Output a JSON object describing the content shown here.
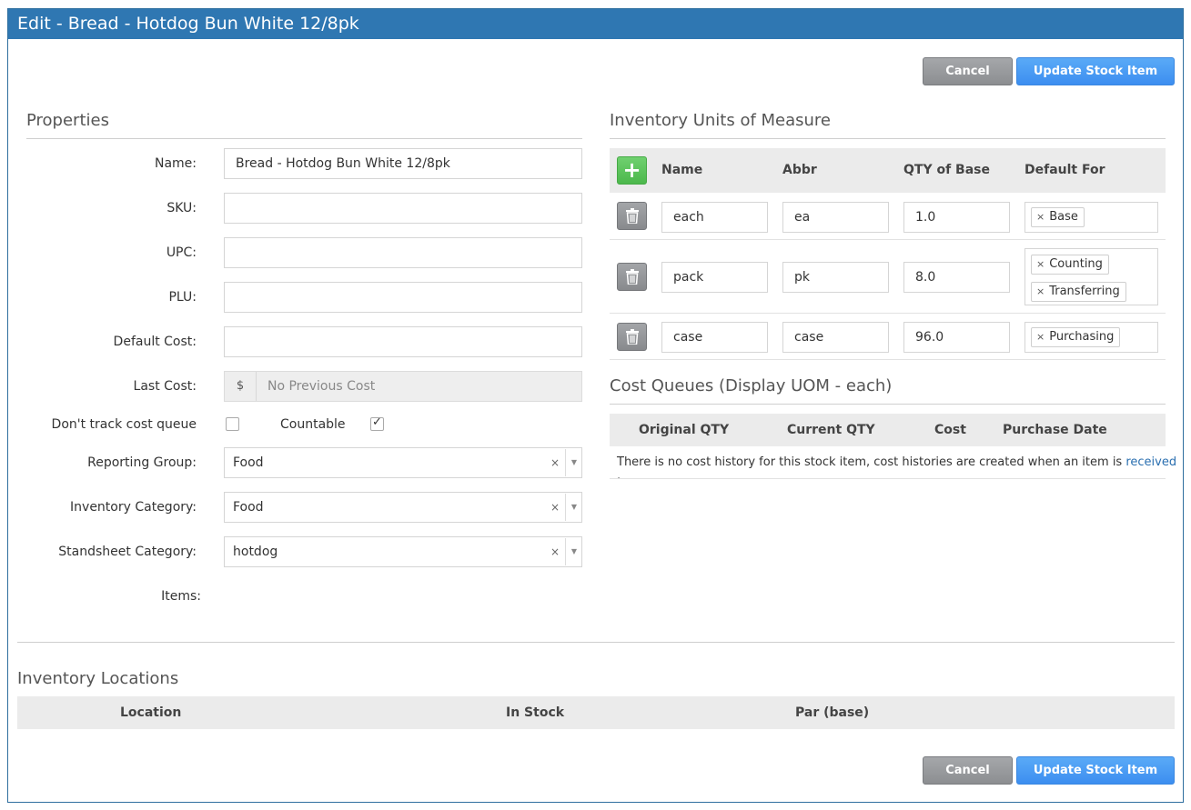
{
  "title": "Edit - Bread - Hotdog Bun White 12/8pk",
  "buttons": {
    "cancel": "Cancel",
    "update": "Update Stock Item"
  },
  "properties": {
    "heading": "Properties",
    "name_label": "Name:",
    "name_value": "Bread - Hotdog Bun White 12/8pk",
    "sku_label": "SKU:",
    "upc_label": "UPC:",
    "plu_label": "PLU:",
    "default_cost_label": "Default Cost:",
    "last_cost_label": "Last Cost:",
    "last_cost_addon": "$",
    "last_cost_placeholder": "No Previous Cost",
    "dont_track_label": "Don't track cost queue",
    "dont_track_checked": false,
    "countable_label": "Countable",
    "countable_checked": true,
    "reporting_group_label": "Reporting Group:",
    "reporting_group_value": "Food",
    "inventory_category_label": "Inventory Category:",
    "inventory_category_value": "Food",
    "standsheet_category_label": "Standsheet Category:",
    "standsheet_category_value": "hotdog",
    "items_label": "Items:",
    "clear_glyph": "×",
    "dropdown_glyph": "▼"
  },
  "uom": {
    "heading": "Inventory Units of Measure",
    "columns": [
      "Name",
      "Abbr",
      "QTY of Base",
      "Default For"
    ],
    "rows": [
      {
        "name": "each",
        "abbr": "ea",
        "qty": "1.0",
        "defaults": [
          "Base"
        ]
      },
      {
        "name": "pack",
        "abbr": "pk",
        "qty": "8.0",
        "defaults": [
          "Counting",
          "Transferring"
        ]
      },
      {
        "name": "case",
        "abbr": "case",
        "qty": "96.0",
        "defaults": [
          "Purchasing"
        ]
      }
    ],
    "tag_remove_glyph": "×",
    "add_glyph": "+"
  },
  "cost_queues": {
    "heading": "Cost Queues (Display UOM - each)",
    "columns": [
      "Original QTY",
      "Current QTY",
      "Cost",
      "Purchase Date"
    ],
    "empty_text": "There is no cost history for this stock item, cost histories are created when an item is",
    "empty_link": "received",
    "empty_end": "."
  },
  "locations": {
    "heading": "Inventory Locations",
    "columns": [
      "Location",
      "In Stock",
      "Par (base)"
    ]
  }
}
